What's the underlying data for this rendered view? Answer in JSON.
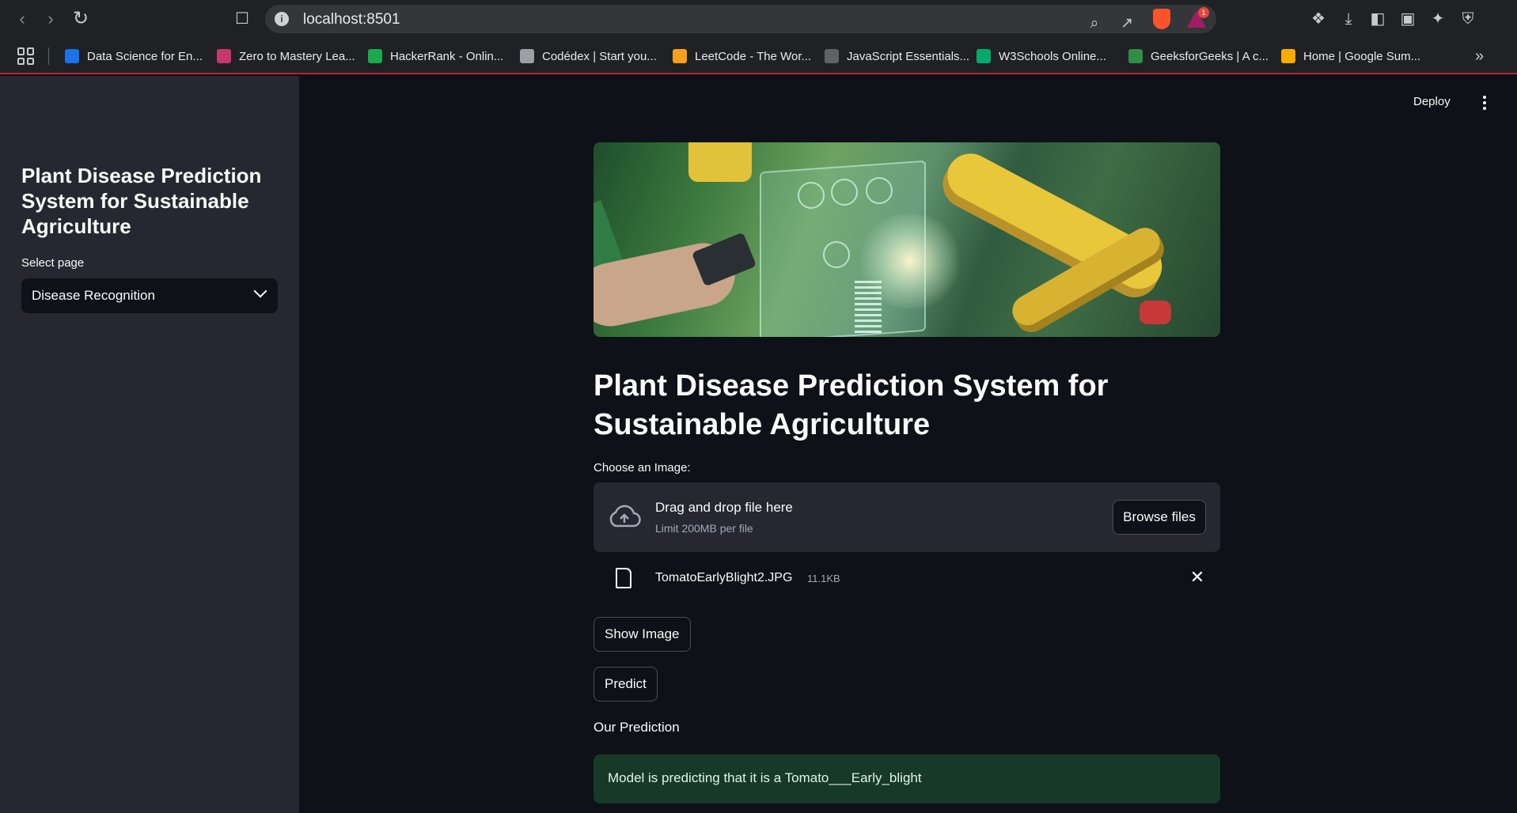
{
  "browser": {
    "url": "localhost:8501",
    "alert_badge": "1",
    "bookmarks": [
      {
        "label": "Data Science for En...",
        "color": "#1a73e8"
      },
      {
        "label": "Zero to Mastery Lea...",
        "color": "#c5376d"
      },
      {
        "label": "HackerRank - Onlin...",
        "color": "#1ba94c"
      },
      {
        "label": "Codédex | Start you...",
        "color": "#9aa0a6"
      },
      {
        "label": "LeetCode - The Wor...",
        "color": "#f89f1b"
      },
      {
        "label": "JavaScript Essentials...",
        "color": "#5f6368"
      },
      {
        "label": "W3Schools Online...",
        "color": "#04aa6d"
      },
      {
        "label": "GeeksforGeeks | A c...",
        "color": "#2f8d46"
      },
      {
        "label": "Home | Google Sum...",
        "color": "#f9ab00"
      }
    ]
  },
  "sidebar": {
    "title": "Plant Disease Prediction System for Sustainable Agriculture",
    "select_label": "Select page",
    "select_value": "Disease Recognition"
  },
  "header": {
    "deploy_label": "Deploy"
  },
  "main": {
    "title": "Plant Disease Prediction System for Sustainable Agriculture",
    "uploader": {
      "label": "Choose an Image:",
      "drag_text": "Drag and drop file here",
      "limit_text": "Limit 200MB per file",
      "browse_label": "Browse files"
    },
    "file": {
      "name": "TomatoEarlyBlight2.JPG",
      "size": "11.1KB"
    },
    "show_image_label": "Show Image",
    "predict_label": "Predict",
    "prediction_label": "Our Prediction",
    "prediction_text": "Model is predicting that it is a Tomato___Early_blight"
  },
  "colors": {
    "app_bg": "#0e1117",
    "sidebar_bg": "#262730",
    "success_bg": "#173928",
    "header_accent": "#b5262d"
  }
}
